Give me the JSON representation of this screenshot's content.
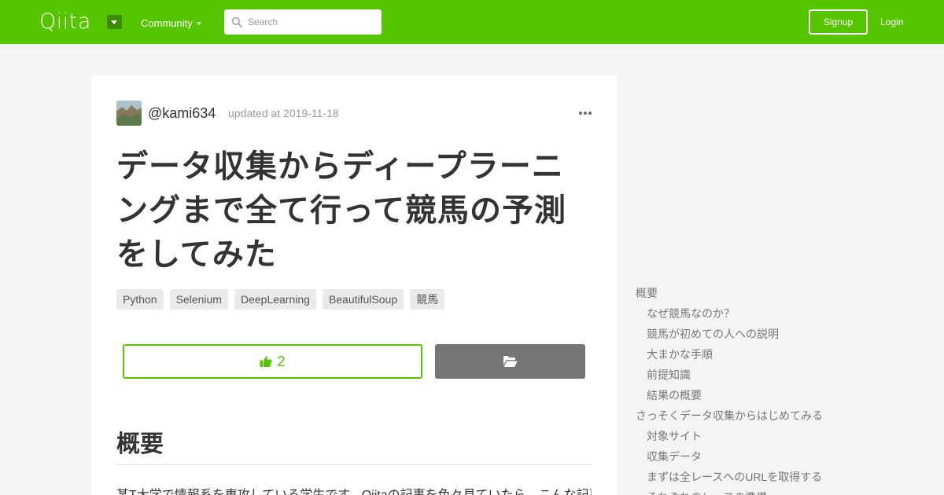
{
  "header": {
    "logo": "Qiita",
    "community_label": "Community",
    "search": {
      "placeholder": "Search",
      "value": ""
    },
    "signup_label": "Signup",
    "login_label": "Login",
    "brand_color": "#55c500"
  },
  "article": {
    "author": "@kami634",
    "updated": "updated at 2019-11-18",
    "title": "データ収集からディープラーニングまで全て行って競馬の予測をしてみた",
    "tags": [
      "Python",
      "Selenium",
      "DeepLearning",
      "BeautifulSoup",
      "競馬"
    ],
    "likes": "2",
    "section_heading": "概要",
    "body_first_line": "某T大学で情報系を専攻している学生です。Qiitaの記事を色々見ていたら、こんな記事"
  },
  "toc": [
    {
      "label": "概要",
      "level": 1
    },
    {
      "label": "なぜ競馬なのか？",
      "level": 2
    },
    {
      "label": "競馬が初めての人への説明",
      "level": 2
    },
    {
      "label": "大まかな手順",
      "level": 2
    },
    {
      "label": "前提知識",
      "level": 2
    },
    {
      "label": "結果の概要",
      "level": 2
    },
    {
      "label": "さっそくデータ収集からはじめてみる",
      "level": 1
    },
    {
      "label": "対象サイト",
      "level": 2
    },
    {
      "label": "収集データ",
      "level": 2
    },
    {
      "label": "まずは全レースへのURLを取得する",
      "level": 2
    },
    {
      "label": "それぞれのレースの準備",
      "level": 2
    }
  ]
}
